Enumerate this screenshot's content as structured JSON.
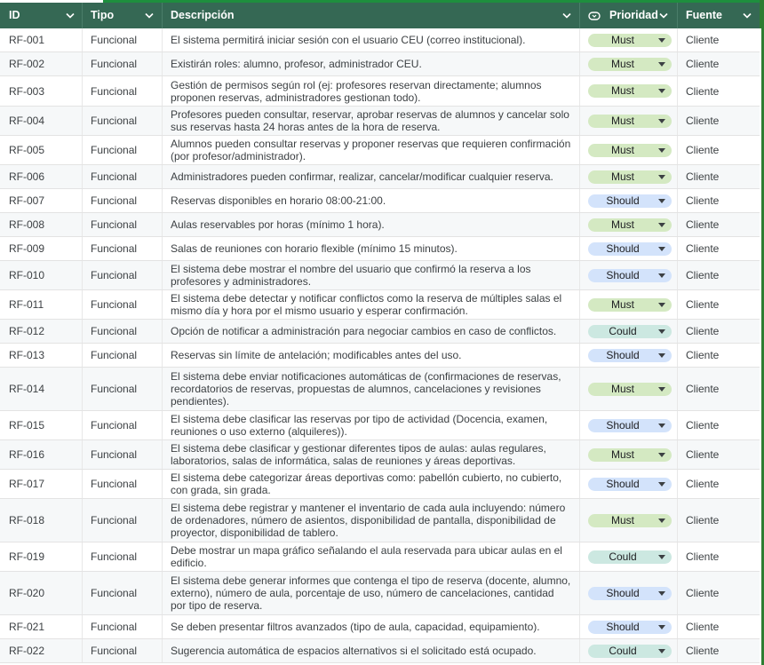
{
  "header": {
    "id": "ID",
    "tipo": "Tipo",
    "descripcion": "Descripción",
    "prioridad": "Prioridad",
    "fuente": "Fuente"
  },
  "colors": {
    "header_bg": "#356854",
    "must": "#d4e9c2",
    "should": "#d3e3fb",
    "could": "#cce8e1"
  },
  "icons": {
    "filter": "chevron-down-icon",
    "prioridad": "dropdown-chip-icon"
  },
  "rows": [
    {
      "id": "RF-001",
      "tipo": "Funcional",
      "desc": "El sistema permitirá iniciar sesión con el usuario CEU (correo institucional).",
      "prio": "Must",
      "fuente": "Cliente"
    },
    {
      "id": "RF-002",
      "tipo": "Funcional",
      "desc": "Existirán roles: alumno, profesor, administrador CEU.",
      "prio": "Must",
      "fuente": "Cliente"
    },
    {
      "id": "RF-003",
      "tipo": "Funcional",
      "desc": "Gestión de permisos según rol (ej: profesores reservan directamente; alumnos proponen reservas, administradores gestionan todo).",
      "prio": "Must",
      "fuente": "Cliente"
    },
    {
      "id": "RF-004",
      "tipo": "Funcional",
      "desc": "Profesores pueden consultar, reservar, aprobar reservas de alumnos y cancelar solo sus reservas hasta 24 horas antes de la hora de reserva.",
      "prio": "Must",
      "fuente": "Cliente"
    },
    {
      "id": "RF-005",
      "tipo": "Funcional",
      "desc": "Alumnos pueden consultar reservas y proponer reservas que requieren confirmación (por profesor/administrador).",
      "prio": "Must",
      "fuente": "Cliente"
    },
    {
      "id": "RF-006",
      "tipo": "Funcional",
      "desc": "Administradores pueden confirmar, realizar, cancelar/modificar cualquier reserva.",
      "prio": "Must",
      "fuente": "Cliente"
    },
    {
      "id": "RF-007",
      "tipo": "Funcional",
      "desc": "Reservas disponibles en horario 08:00-21:00.",
      "prio": "Should",
      "fuente": "Cliente"
    },
    {
      "id": "RF-008",
      "tipo": "Funcional",
      "desc": "Aulas reservables por horas (mínimo 1 hora).",
      "prio": "Must",
      "fuente": "Cliente"
    },
    {
      "id": "RF-009",
      "tipo": "Funcional",
      "desc": "Salas de reuniones con horario flexible (mínimo 15 minutos).",
      "prio": "Should",
      "fuente": "Cliente"
    },
    {
      "id": "RF-010",
      "tipo": "Funcional",
      "desc": "El sistema debe mostrar el nombre del usuario que confirmó la reserva a los profesores y administradores.",
      "prio": "Should",
      "fuente": "Cliente"
    },
    {
      "id": "RF-011",
      "tipo": "Funcional",
      "desc": "El sistema debe detectar y notificar conflictos como la reserva de múltiples salas el mismo día y hora por el mismo usuario y esperar confirmación.",
      "prio": "Must",
      "fuente": "Cliente"
    },
    {
      "id": "RF-012",
      "tipo": "Funcional",
      "desc": "Opción de notificar a administración para negociar cambios en caso de conflictos.",
      "prio": "Could",
      "fuente": "Cliente"
    },
    {
      "id": "RF-013",
      "tipo": "Funcional",
      "desc": "Reservas sin límite de antelación; modificables antes del uso.",
      "prio": "Should",
      "fuente": "Cliente"
    },
    {
      "id": "RF-014",
      "tipo": "Funcional",
      "desc": "El sistema debe enviar notificaciones automáticas de (confirmaciones de reservas, recordatorios de reservas, propuestas de alumnos, cancelaciones y revisiones pendientes).",
      "prio": "Must",
      "fuente": "Cliente"
    },
    {
      "id": "RF-015",
      "tipo": "Funcional",
      "desc": "El sistema debe clasificar las reservas por tipo de actividad (Docencia, examen, reuniones o uso externo (alquileres)).",
      "prio": "Should",
      "fuente": "Cliente"
    },
    {
      "id": "RF-016",
      "tipo": "Funcional",
      "desc": "El sistema debe clasificar y gestionar diferentes tipos de aulas: aulas regulares, laboratorios, salas de informática, salas de reuniones y áreas deportivas.",
      "prio": "Must",
      "fuente": "Cliente"
    },
    {
      "id": "RF-017",
      "tipo": "Funcional",
      "desc": "El sistema debe categorizar áreas deportivas como: pabellón cubierto, no cubierto, con grada, sin grada.",
      "prio": "Should",
      "fuente": "Cliente"
    },
    {
      "id": "RF-018",
      "tipo": "Funcional",
      "desc": "El sistema debe registrar y mantener el inventario de cada aula incluyendo: número de ordenadores, número de asientos, disponibilidad de pantalla, disponibilidad de proyector, disponibilidad de tablero.",
      "prio": "Must",
      "fuente": "Cliente"
    },
    {
      "id": "RF-019",
      "tipo": "Funcional",
      "desc": "Debe mostrar un mapa gráfico señalando el aula reservada para ubicar aulas en el edificio.",
      "prio": "Could",
      "fuente": "Cliente"
    },
    {
      "id": "RF-020",
      "tipo": "Funcional",
      "desc": "El sistema debe generar informes que contenga el tipo de reserva (docente, alumno, externo), número de aula, porcentaje de uso, número de cancelaciones, cantidad por tipo de reserva.",
      "prio": "Should",
      "fuente": "Cliente"
    },
    {
      "id": "RF-021",
      "tipo": "Funcional",
      "desc": "Se deben presentar filtros avanzados (tipo de aula, capacidad, equipamiento).",
      "prio": "Should",
      "fuente": "Cliente"
    },
    {
      "id": "RF-022",
      "tipo": "Funcional",
      "desc": "Sugerencia automática de espacios alternativos si el solicitado está ocupado.",
      "prio": "Could",
      "fuente": "Cliente"
    }
  ]
}
